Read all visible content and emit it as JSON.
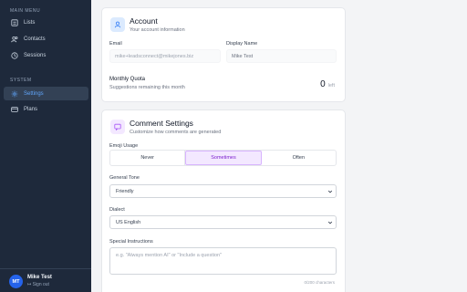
{
  "sidebar": {
    "main_menu_label": "MAIN MENU",
    "system_label": "SYSTEM",
    "items": [
      {
        "label": "Lists",
        "icon": "list-icon"
      },
      {
        "label": "Contacts",
        "icon": "users-icon"
      },
      {
        "label": "Sessions",
        "icon": "clock-icon"
      },
      {
        "label": "Settings",
        "icon": "gear-icon",
        "active": true
      },
      {
        "label": "Plans",
        "icon": "card-icon"
      }
    ],
    "user": {
      "initials": "MT",
      "name": "Mike Test",
      "sign_out": "Sign out"
    }
  },
  "account": {
    "title": "Account",
    "subtitle": "Your account information",
    "email_label": "Email",
    "email_value": "mike+leadsconnect@mikejones.biz",
    "display_name_label": "Display Name",
    "display_name_value": "Mike Test",
    "quota_label": "Monthly Quota",
    "quota_sub": "Suggestions remaining this month",
    "quota_value": "0",
    "quota_unit": "left"
  },
  "comment_settings": {
    "title": "Comment Settings",
    "subtitle": "Customize how comments are generated",
    "emoji_label": "Emoji Usage",
    "emoji_options": [
      "Never",
      "Sometimes",
      "Often"
    ],
    "emoji_selected": "Sometimes",
    "tone_label": "General Tone",
    "tone_value": "Friendly",
    "dialect_label": "Dialect",
    "dialect_value": "US English",
    "instructions_label": "Special Instructions",
    "instructions_placeholder": "e.g. \"Always mention AI\" or \"Include a question\"",
    "char_count": "0/200 characters"
  },
  "colors": {
    "sidebar_bg": "#1e293b",
    "accent_blue": "#2563eb",
    "accent_purple": "#a855f7"
  }
}
